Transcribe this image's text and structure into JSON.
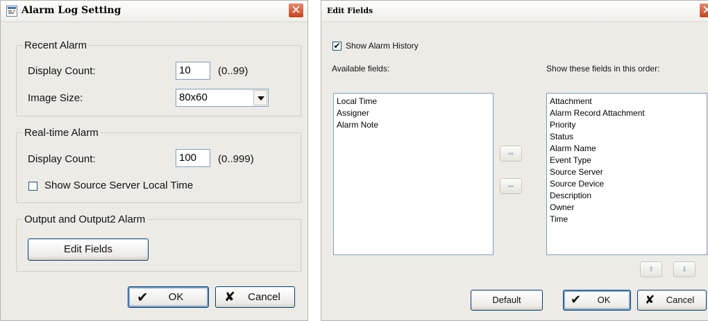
{
  "alarm_log_setting": {
    "title": "Alarm Log Setting",
    "recent_alarm": {
      "legend": "Recent Alarm",
      "display_count_label": "Display Count:",
      "display_count_value": "10",
      "display_count_range": "(0..99)",
      "image_size_label": "Image Size:",
      "image_size_value": "80x60"
    },
    "realtime_alarm": {
      "legend": "Real-time Alarm",
      "display_count_label": "Display Count:",
      "display_count_value": "100",
      "display_count_range": "(0..999)",
      "show_local_time_label": "Show Source Server Local Time",
      "show_local_time_checked": false
    },
    "output_alarm": {
      "legend": "Output and Output2 Alarm",
      "edit_fields_label": "Edit Fields"
    },
    "ok_label": "OK",
    "cancel_label": "Cancel"
  },
  "edit_fields": {
    "title": "Edit Fields",
    "show_history_label": "Show Alarm History",
    "show_history_checked": true,
    "available_label": "Available fields:",
    "order_label": "Show these fields in this order:",
    "available_fields": [
      "Local Time",
      "Assigner",
      "Alarm Note"
    ],
    "shown_fields": [
      "Attachment",
      "Alarm Record Attachment",
      "Priority",
      "Status",
      "Alarm Name",
      "Event Type",
      "Source Server",
      "Source Device",
      "Description",
      "Owner",
      "Time"
    ],
    "default_label": "Default",
    "ok_label": "OK",
    "cancel_label": "Cancel"
  },
  "icons": {
    "close": "close-icon",
    "app": "settings-window-icon",
    "ok": "checkmark-icon",
    "cancel": "x-icon",
    "move_right": "arrow-right-icon",
    "move_left": "arrow-left-icon",
    "move_up": "arrow-up-icon",
    "move_down": "arrow-down-icon"
  },
  "colors": {
    "close_button": "#c9421b",
    "window_bg": "#ecebe6",
    "input_border": "#7f9db9"
  }
}
